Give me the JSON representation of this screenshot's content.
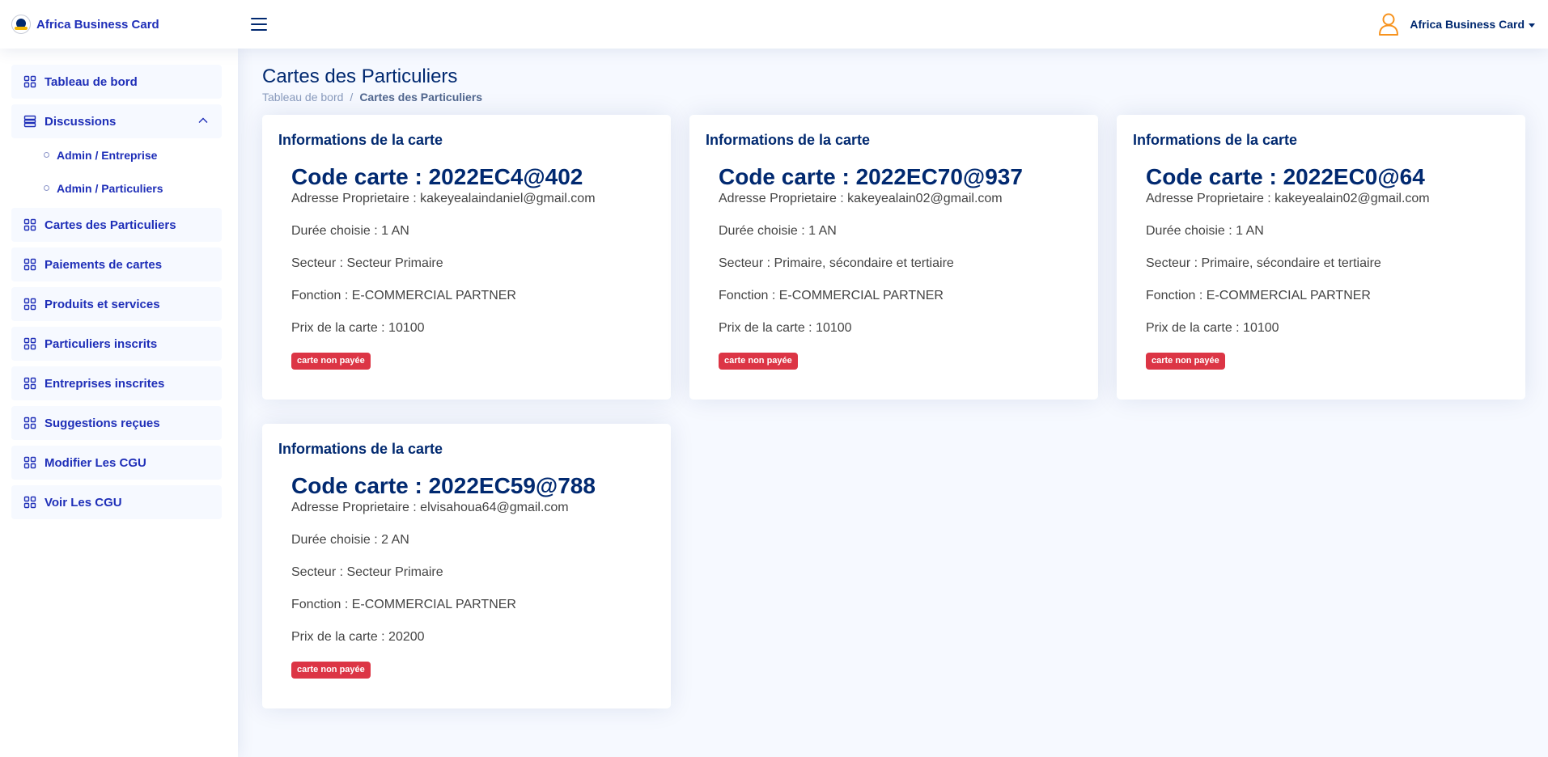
{
  "header": {
    "brand": "Africa Business Card",
    "user_name": "Africa Business Card"
  },
  "colors": {
    "accent": "#1f2fb8",
    "navy": "#012970",
    "badge_red": "#dc3545",
    "profile_orange": "#f7931e"
  },
  "sidebar": {
    "items": [
      {
        "label": "Tableau de bord",
        "icon": "grid-icon"
      },
      {
        "label": "Discussions",
        "icon": "menu-list-icon",
        "expanded": true,
        "children": [
          {
            "label": "Admin / Entreprise"
          },
          {
            "label": "Admin / Particuliers"
          }
        ]
      },
      {
        "label": "Cartes des Particuliers",
        "icon": "grid-icon"
      },
      {
        "label": "Paiements de cartes",
        "icon": "grid-icon"
      },
      {
        "label": "Produits et services",
        "icon": "grid-icon"
      },
      {
        "label": "Particuliers inscrits",
        "icon": "grid-icon"
      },
      {
        "label": "Entreprises inscrites",
        "icon": "grid-icon"
      },
      {
        "label": "Suggestions reçues",
        "icon": "grid-icon"
      },
      {
        "label": "Modifier Les CGU",
        "icon": "grid-icon"
      },
      {
        "label": "Voir Les CGU",
        "icon": "grid-icon"
      }
    ]
  },
  "page": {
    "title": "Cartes des Particuliers",
    "breadcrumb": {
      "home": "Tableau de bord",
      "separator": "/",
      "current": "Cartes des Particuliers"
    }
  },
  "cards": [
    {
      "title": "Informations de la carte",
      "code": "Code carte : 2022EC4@402",
      "owner": "Adresse Proprietaire : kakeyealaindaniel@gmail.com",
      "duration": "Durée choisie : 1 AN",
      "sector": "Secteur : Secteur Primaire",
      "function": "Fonction : E-COMMERCIAL PARTNER",
      "price": "Prix de la carte : 10100",
      "status": "carte non payée"
    },
    {
      "title": "Informations de la carte",
      "code": "Code carte : 2022EC70@937",
      "owner": "Adresse Proprietaire : kakeyealain02@gmail.com",
      "duration": "Durée choisie : 1 AN",
      "sector": "Secteur : Primaire, sécondaire et tertiaire",
      "function": "Fonction : E-COMMERCIAL PARTNER",
      "price": "Prix de la carte : 10100",
      "status": "carte non payée"
    },
    {
      "title": "Informations de la carte",
      "code": "Code carte : 2022EC0@64",
      "owner": "Adresse Proprietaire : kakeyealain02@gmail.com",
      "duration": "Durée choisie : 1 AN",
      "sector": "Secteur : Primaire, sécondaire et tertiaire",
      "function": "Fonction : E-COMMERCIAL PARTNER",
      "price": "Prix de la carte : 10100",
      "status": "carte non payée"
    },
    {
      "title": "Informations de la carte",
      "code": "Code carte : 2022EC59@788",
      "owner": "Adresse Proprietaire : elvisahoua64@gmail.com",
      "duration": "Durée choisie : 2 AN",
      "sector": "Secteur : Secteur Primaire",
      "function": "Fonction : E-COMMERCIAL PARTNER",
      "price": "Prix de la carte : 20200",
      "status": "carte non payée"
    }
  ]
}
